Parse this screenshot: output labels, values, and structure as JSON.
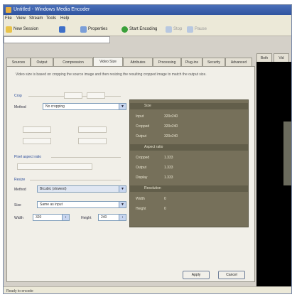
{
  "window": {
    "title": "Untitled - Windows Media Encoder"
  },
  "menu": [
    "File",
    "View",
    "Stream",
    "Tools",
    "Help"
  ],
  "toolbar": {
    "new_session": "New Session",
    "properties": "Properties",
    "start_encoding": "Start Encoding",
    "stop": "Stop",
    "pause": "Pause"
  },
  "pathbar": "",
  "tabs": [
    "Sources",
    "Output",
    "Compression",
    "Video Size",
    "Attributes",
    "Processing",
    "Plug-ins",
    "Security",
    "Advanced"
  ],
  "active_tab_index": 3,
  "panel": {
    "description": "Video size is based on cropping the source image and then resizing the resulting cropped image to match the output size.",
    "crop_group": "Crop",
    "crop_method_label": "Method",
    "crop_method_value": "No cropping",
    "pixel_group": "Pixel aspect ratio",
    "resize_group": "Resize",
    "resize_method_label": "Method",
    "resize_method_value": "Bicubic (slowest)",
    "size_label": "Size",
    "size_value": "Same as input",
    "width_label": "Width",
    "width_value": "320",
    "height_label": "Height",
    "height_value": "240"
  },
  "stats": {
    "header": "Size",
    "rows": [
      {
        "label": "Input",
        "value": "320x240"
      },
      {
        "label": "Cropped",
        "value": "320x240"
      },
      {
        "label": "Output",
        "value": "320x240"
      }
    ],
    "aspect_header": "Aspect ratio",
    "aspect_rows": [
      {
        "label": "Cropped",
        "value": "1.333"
      },
      {
        "label": "Output",
        "value": "1.333"
      },
      {
        "label": "Display",
        "value": "1.333"
      }
    ],
    "resolution_header": "Resolution",
    "resolution_rows": [
      {
        "label": "Width",
        "value": "0"
      },
      {
        "label": "Height",
        "value": "0"
      }
    ]
  },
  "buttons": {
    "apply": "Apply",
    "cancel": "Cancel"
  },
  "viewport_tabs": [
    "Both",
    "Vid"
  ],
  "status": "Ready to encode"
}
